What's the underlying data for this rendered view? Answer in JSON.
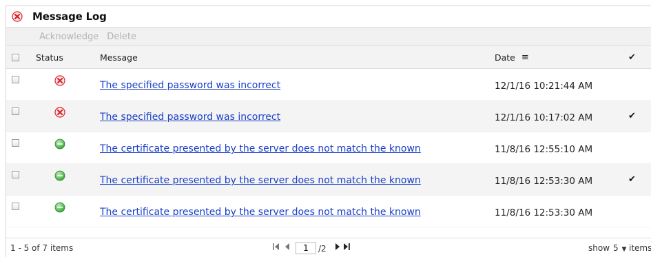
{
  "title": "Message Log",
  "toolbar": {
    "acknowledge": "Acknowledge",
    "delete": "Delete"
  },
  "columns": {
    "status": "Status",
    "message": "Message",
    "date": "Date",
    "ack": "✔",
    "sort_icon": "≡"
  },
  "icons": {
    "error": "error-x-icon",
    "ok": "ok-green-icon"
  },
  "colors": {
    "error": "#d8222a",
    "ok": "#3aa53a",
    "link": "#1a40c8"
  },
  "rows": [
    {
      "status": "error",
      "message": "The specified password was incorrect",
      "date": "12/1/16 10:21:44 AM",
      "ack": ""
    },
    {
      "status": "error",
      "message": "The specified password was incorrect",
      "date": "12/1/16 10:17:02 AM",
      "ack": "✔"
    },
    {
      "status": "ok",
      "message": "The certificate presented by the server does not match the known",
      "date": "11/8/16 12:55:10 AM",
      "ack": ""
    },
    {
      "status": "ok",
      "message": "The certificate presented by the server does not match the known",
      "date": "11/8/16 12:53:30 AM",
      "ack": "✔"
    },
    {
      "status": "ok",
      "message": "The certificate presented by the server does not match the known",
      "date": "11/8/16 12:53:30 AM",
      "ack": ""
    }
  ],
  "footer": {
    "items_summary": "1 - 5 of 7 items",
    "current_page": "1",
    "total_pages": "/2",
    "show_label": "show",
    "page_size": "5",
    "items_label": "items"
  }
}
